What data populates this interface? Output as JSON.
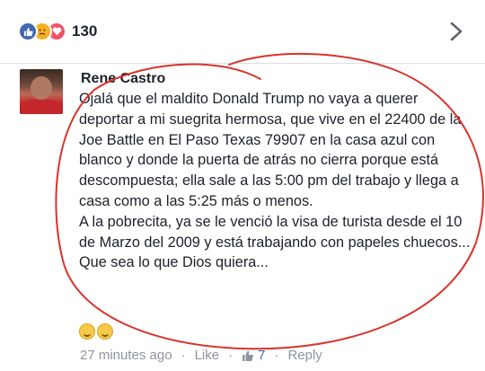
{
  "reactions": {
    "icons": [
      "like-icon",
      "sad-icon",
      "love-icon"
    ],
    "count": "130"
  },
  "comment": {
    "author": "Rene Castro",
    "paragraphs": [
      "Ojalá que el maldito Donald Trump no vaya a querer deportar a mi suegrita hermosa, que vive en el 22400 de la Joe Battle en El Paso Texas 79907 en la casa azul con blanco y donde la puerta de atrás no cierra porque está descompuesta; ella sale a las 5:00 pm del trabajo y llega a casa como a las 5:25 más o menos.",
      "A la pobrecita, ya se le venció la visa de turista desde el 10 de Marzo del 2009 y está trabajando con papeles chuecos...",
      "Que sea lo que Dios quiera..."
    ],
    "emojis": [
      "grinning-sweat-emoji",
      "grimacing-emoji"
    ],
    "timestamp": "27 minutes ago",
    "separator": "·",
    "like_label": "Like",
    "like_count": "7",
    "reply_label": "Reply"
  },
  "colors": {
    "accent": "#4267b2",
    "annotation": "#d9332c",
    "meta_text": "#90949c"
  }
}
